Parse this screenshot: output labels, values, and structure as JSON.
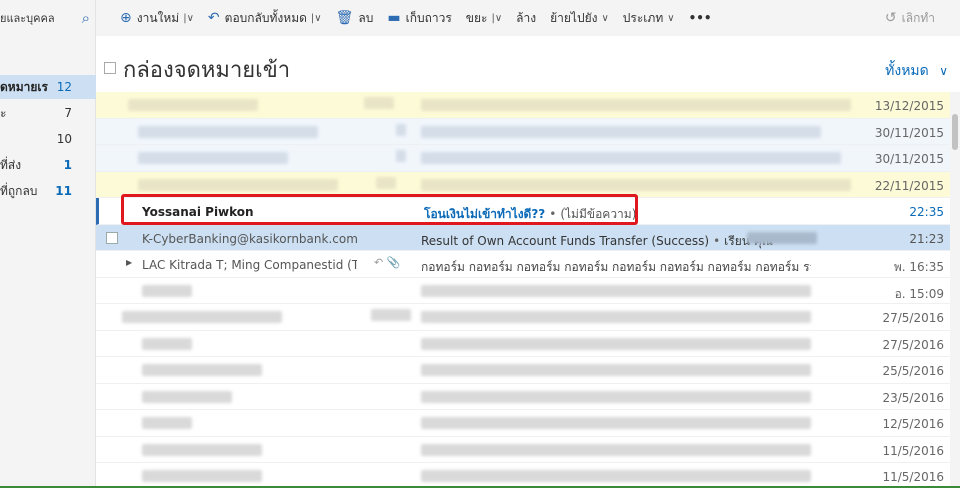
{
  "sidebar": {
    "search_label": "ยและบุคคล",
    "items": [
      {
        "label": "ดหมายเร",
        "count": "12"
      },
      {
        "label": "ะ",
        "count": "7"
      },
      {
        "label": "",
        "count": "10"
      },
      {
        "label": "ที่ส่ง",
        "count": "1"
      },
      {
        "label": "ที่ถูกลบ",
        "count": "11"
      }
    ]
  },
  "toolbar": {
    "new_label": "งานใหม่",
    "reply_all_label": "ตอบกลับทั้งหมด",
    "delete_label": "ลบ",
    "archive_label": "เก็บถาวร",
    "junk_label": "ขยะ",
    "sweep_label": "ล้าง",
    "move_label": "ย้ายไปยัง",
    "categories_label": "ประเภท",
    "more_label": "•••",
    "undo_label": "เลิกทำ"
  },
  "header": {
    "title": "กล่องจดหมายเข้า",
    "filter_label": "ทั้งหมด"
  },
  "messages": [
    {
      "from": "",
      "subject": "",
      "preview": "",
      "date": "13/12/2015"
    },
    {
      "from": "",
      "subject": "",
      "preview": "",
      "date": "30/11/2015"
    },
    {
      "from": "",
      "subject": "",
      "preview": "",
      "date": "30/11/2015"
    },
    {
      "from": "",
      "subject": "",
      "preview": "",
      "date": "22/11/2015"
    },
    {
      "from": "Yossanai Piwkon",
      "subject": "โอนเงินไม่เข้าทำไงดี??",
      "preview": "(ไม่มีข้อความ)",
      "date": "22:35"
    },
    {
      "from": "K-CyberBanking@kasikornbank.com",
      "subject": "Result of Own Account Funds Transfer (Success)",
      "preview": "เรียน คุณ",
      "date": "21:23"
    },
    {
      "from": "LAC Kitrada T; Ming Companestid (TH);",
      "subject": "กอทอร์ม กอทอร์ม กอทอร์ม กอทอร์ม กอทอร์ม กอทอร์ม กอทอร์ม กอทอร์ม ราคา",
      "preview": "",
      "date": "พ. 16:35"
    },
    {
      "from": "",
      "subject": "",
      "preview": "",
      "date": "อ. 15:09"
    },
    {
      "from": "",
      "subject": "",
      "preview": "",
      "date": "27/5/2016"
    },
    {
      "from": "",
      "subject": "",
      "preview": "",
      "date": "27/5/2016"
    },
    {
      "from": "",
      "subject": "",
      "preview": "",
      "date": "25/5/2016"
    },
    {
      "from": "",
      "subject": "",
      "preview": "",
      "date": "23/5/2016"
    },
    {
      "from": "",
      "subject": "",
      "preview": "",
      "date": "12/5/2016"
    },
    {
      "from": "",
      "subject": "",
      "preview": "",
      "date": "11/5/2016"
    },
    {
      "from": "",
      "subject": "",
      "preview": "",
      "date": "11/5/2016"
    }
  ]
}
